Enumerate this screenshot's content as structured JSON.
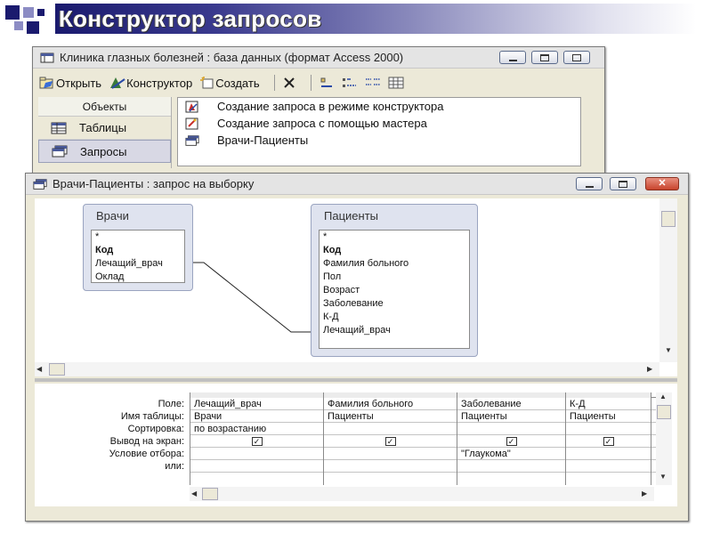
{
  "slide": {
    "title": "Конструктор запросов"
  },
  "db_window": {
    "title": "Клиника глазных болезней : база данных (формат Access 2000)",
    "toolbar": {
      "open_label": "Открыть",
      "design_label": "Конструктор",
      "create_label": "Создать"
    },
    "objects": {
      "header": "Объекты",
      "items": [
        {
          "label": "Таблицы",
          "icon": "table-icon"
        },
        {
          "label": "Запросы",
          "icon": "query-icon"
        }
      ]
    },
    "list": [
      {
        "label": "Создание запроса в режиме конструктора",
        "icon": "design-wizard-icon"
      },
      {
        "label": "Создание запроса с помощью мастера",
        "icon": "wizard-icon"
      },
      {
        "label": "Врачи-Пациенты",
        "icon": "query-icon"
      }
    ]
  },
  "query_window": {
    "title": "Врачи-Пациенты : запрос на выборку",
    "tables": [
      {
        "name": "Врачи",
        "fields": [
          "*",
          "Код",
          "Лечащий_врач",
          "Оклад"
        ],
        "bold": [
          "Код"
        ]
      },
      {
        "name": "Пациенты",
        "fields": [
          "*",
          "Код",
          "Фамилия больного",
          "Пол",
          "Возраст",
          "Заболевание",
          "К-Д",
          "Лечащий_врач"
        ],
        "bold": [
          "Код"
        ]
      }
    ],
    "grid": {
      "row_labels": [
        "Поле:",
        "Имя таблицы:",
        "Сортировка:",
        "Вывод на экран:",
        "Условие отбора:",
        "или:"
      ],
      "columns": [
        {
          "field": "Лечащий_врач",
          "table": "Врачи",
          "sort": "по возрастанию",
          "show": true,
          "criteria": "",
          "or": ""
        },
        {
          "field": "Фамилия больного",
          "table": "Пациенты",
          "sort": "",
          "show": true,
          "criteria": "",
          "or": ""
        },
        {
          "field": "Заболевание",
          "table": "Пациенты",
          "sort": "",
          "show": true,
          "criteria": "\"Глаукома\"",
          "or": ""
        },
        {
          "field": "К-Д",
          "table": "Пациенты",
          "sort": "",
          "show": true,
          "criteria": "",
          "or": ""
        }
      ]
    }
  },
  "colors": {
    "title_blue": "#1a1a6e",
    "selection": "#d8d8e4"
  }
}
